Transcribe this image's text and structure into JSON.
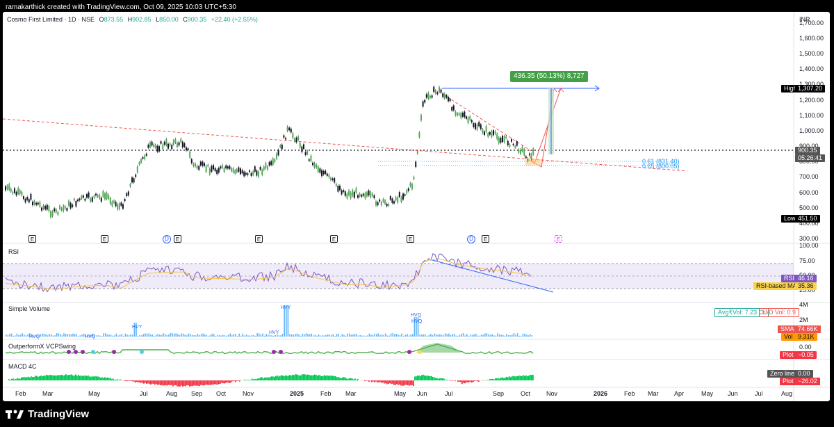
{
  "header": {
    "credit": "ramakarthick created with TradingView.com, Oct 09, 2025 10:03 UTC+5:30"
  },
  "symbol": {
    "name": "Cosmo First Limited · 1D · NSE",
    "open_label": "O",
    "open": "873.55",
    "high_label": "H",
    "high": "902.85",
    "low_label": "L",
    "low": "850.00",
    "close_label": "C",
    "close": "900.35",
    "change": "+22.40 (+2.55%)"
  },
  "price_axis": {
    "currency": "INR",
    "ticks": [
      "1,700.00",
      "1,600.00",
      "1,500.00",
      "1,400.00",
      "1,300.00",
      "1,200.00",
      "1,100.00",
      "1,000.00",
      "900.00",
      "800.00",
      "700.00",
      "600.00",
      "500.00",
      "400.00",
      "300.00"
    ],
    "high_label": "High",
    "high_value": "1,307.20",
    "low_label": "Low",
    "low_value": "451.50",
    "last_price": "900.35",
    "countdown": "05:26:41"
  },
  "annotations": {
    "measure_box": "436.35 (50.13%) 8,727",
    "fib_061": "0.61 (831.40)",
    "fib_065": "0.65 (800.05)"
  },
  "events": [
    "E",
    "E",
    "D",
    "E",
    "E",
    "E",
    "E",
    "D",
    "E",
    "E"
  ],
  "rsi": {
    "title": "RSI",
    "ticks": [
      "100.00",
      "75.00",
      "50.00",
      "25.00"
    ],
    "rsi_label": "RSI",
    "rsi_value": "46.16",
    "ma_label": "RSI-based MA",
    "ma_value": "35.36"
  },
  "volume": {
    "title": "Simple Volume",
    "avg_vol": "Avg₹Vol: 7.23 Cr",
    "ud_vol": "U/D Vol: 0.9",
    "ticks": [
      "4M",
      "2M"
    ],
    "sma_label": "SMA",
    "sma_value": "74.66K",
    "vol_label": "Vol",
    "vol_value": "9.31K",
    "markers": [
      "HVQ",
      "HVQ",
      "HVY",
      "HVY",
      "HVY",
      "HVQ",
      "HVQ"
    ]
  },
  "vcp": {
    "title": "OutperformX VCPSwing",
    "ticks": [
      "0.00"
    ],
    "plot_label": "Plot",
    "plot_value": "−0.05"
  },
  "macd": {
    "title": "MACD 4C",
    "zero_label": "Zero line",
    "zero_value": "0.00",
    "plot_label": "Plot",
    "plot_value": "−26.02"
  },
  "time_axis": {
    "labels": [
      "Feb",
      "Mar",
      "May",
      "Jul",
      "Aug",
      "Sep",
      "Oct",
      "Nov",
      "2025",
      "Feb",
      "Mar",
      "May",
      "Jun",
      "Jul",
      "Sep",
      "Oct",
      "Nov",
      "2026",
      "Feb",
      "Mar",
      "Apr",
      "May",
      "Jun",
      "Jul",
      "Aug"
    ]
  },
  "footer": {
    "brand": "TradingView"
  },
  "colors": {
    "up": "#26a69a",
    "down": "#ef5350",
    "candle": "#000000",
    "measure": "#4caf50",
    "rsi_line": "#7e57c2",
    "rsi_ma": "#f5c542"
  },
  "icons": {
    "logo": "tradingview-logo-icon"
  }
}
